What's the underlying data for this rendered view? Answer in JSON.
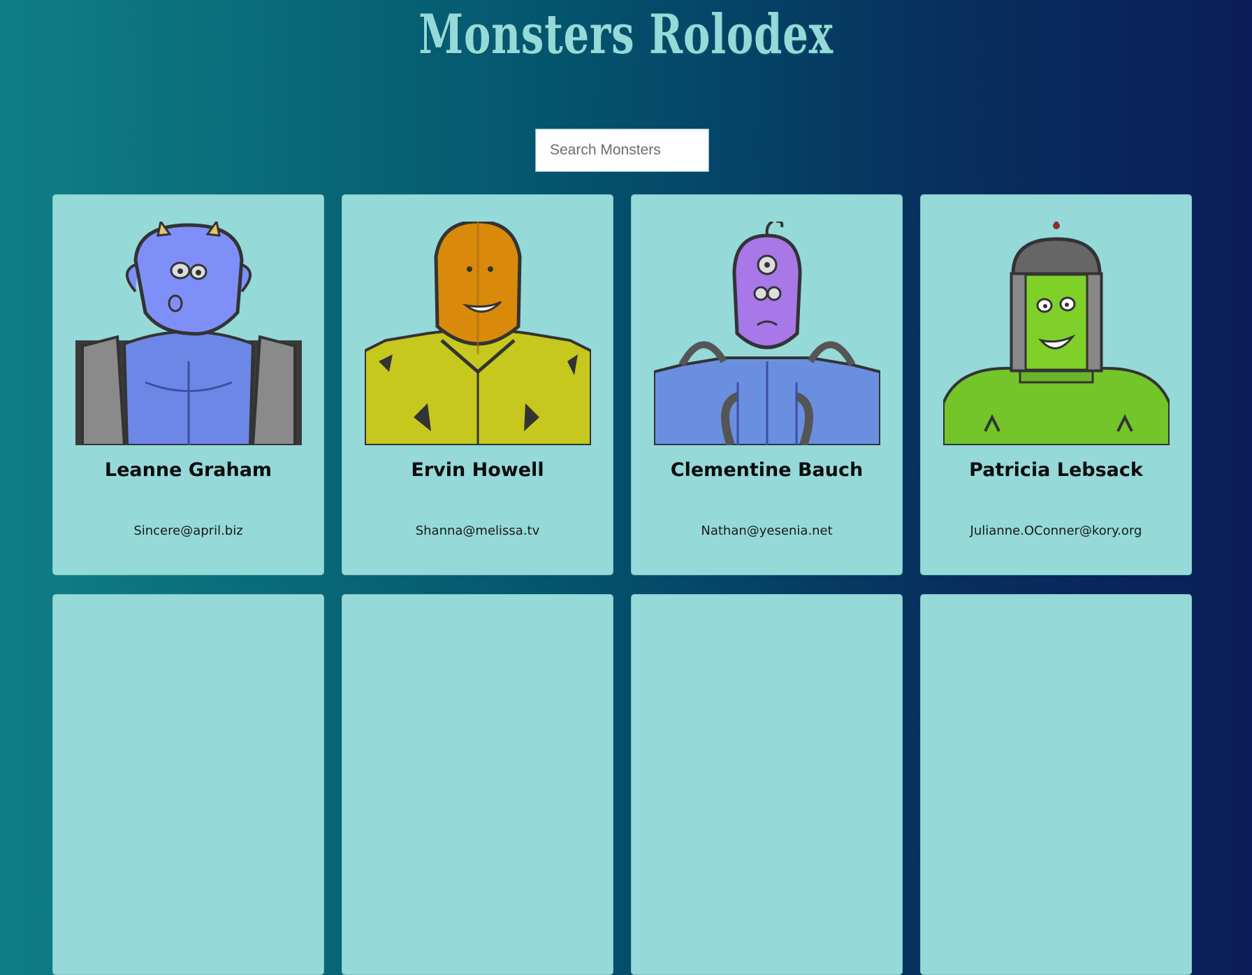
{
  "header": {
    "title": "Monsters Rolodex"
  },
  "search": {
    "placeholder": "Search Monsters",
    "value": ""
  },
  "monsters": [
    {
      "name": "Leanne Graham",
      "email": "Sincere@april.biz",
      "avatar": "blue-horned-monster-icon",
      "skin": "#7f8ff8",
      "body": "#6d87e6"
    },
    {
      "name": "Ervin Howell",
      "email": "Shanna@melissa.tv",
      "avatar": "orange-hooded-monster-icon",
      "skin": "#d98a0a",
      "body": "#c6c81e"
    },
    {
      "name": "Clementine Bauch",
      "email": "Nathan@yesenia.net",
      "avatar": "purple-three-eyed-robot-icon",
      "skin": "#a877e8",
      "body": "#6b8fe0"
    },
    {
      "name": "Patricia Lebsack",
      "email": "Julianne.OConner@kory.org",
      "avatar": "green-frankenstein-robot-icon",
      "skin": "#7fd12a",
      "body": "#73c52a"
    },
    {
      "name": "",
      "email": "",
      "avatar": ""
    },
    {
      "name": "",
      "email": "",
      "avatar": ""
    },
    {
      "name": "",
      "email": "",
      "avatar": ""
    },
    {
      "name": "",
      "email": "",
      "avatar": ""
    }
  ]
}
